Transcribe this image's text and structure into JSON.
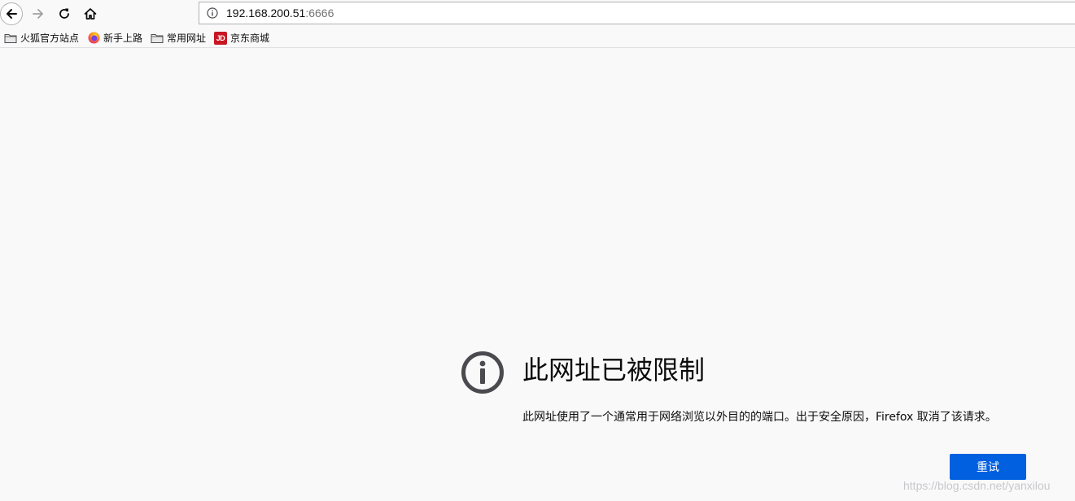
{
  "browser": {
    "url_host": "192.168.200.51",
    "url_port": ":6666",
    "nav": {
      "back_icon": "arrow-left-icon",
      "forward_icon": "arrow-right-icon",
      "reload_icon": "reload-icon",
      "home_icon": "home-icon"
    }
  },
  "bookmarks": [
    {
      "label": "火狐官方站点",
      "icon": "folder-icon"
    },
    {
      "label": "新手上路",
      "icon": "firefox-icon"
    },
    {
      "label": "常用网址",
      "icon": "folder-icon"
    },
    {
      "label": "京东商城",
      "icon": "jd-icon",
      "icon_text": "JD"
    }
  ],
  "error": {
    "title": "此网址已被限制",
    "description": "此网址使用了一个通常用于网络浏览以外目的的端口。出于安全原因，Firefox 取消了该请求。",
    "retry_label": "重试",
    "icon": "info-icon"
  },
  "watermark": "https://blog.csdn.net/yanxilou",
  "colors": {
    "accent": "#0060df",
    "background": "#f9f9fa",
    "icon": "#4a4a4f",
    "jd_red": "#c81623"
  }
}
